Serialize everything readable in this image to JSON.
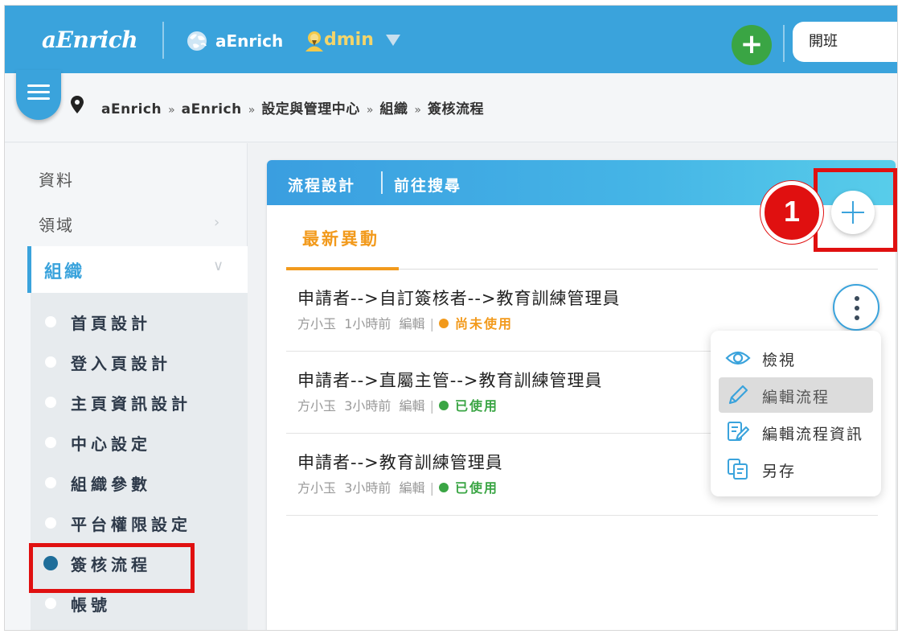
{
  "header": {
    "logo": "aEnrich",
    "org_name": "aEnrich",
    "user_name": "dmin",
    "add_label": "+",
    "search_value": "開班"
  },
  "breadcrumb": [
    "aEnrich",
    "aEnrich",
    "設定與管理中心",
    "組織",
    "簽核流程"
  ],
  "breadcrumb_separator": "»",
  "sidebar": {
    "top_items": [
      {
        "label": "資料"
      },
      {
        "label": "領域"
      }
    ],
    "expanded": {
      "label": "組織"
    },
    "sub_items": [
      {
        "label": "首頁設計"
      },
      {
        "label": "登入頁設計"
      },
      {
        "label": "主頁資訊設計"
      },
      {
        "label": "中心設定"
      },
      {
        "label": "組織參數"
      },
      {
        "label": "平台權限設定"
      },
      {
        "label": "簽核流程",
        "active": true
      },
      {
        "label": "帳號"
      }
    ]
  },
  "card": {
    "title": "流程設計",
    "link": "前往搜尋",
    "tab": "最新異動",
    "rows": [
      {
        "title": "申請者-->自訂簽核者-->教育訓練管理員",
        "author": "方小玉",
        "time": "1小時前",
        "action": "編輯",
        "status": "尚未使用",
        "status_color": "#f29a1c"
      },
      {
        "title": "申請者-->直屬主管-->教育訓練管理員",
        "author": "方小玉",
        "time": "3小時前",
        "action": "編輯",
        "status": "已使用",
        "status_color": "#3aa544"
      },
      {
        "title": "申請者-->教育訓練管理員",
        "author": "方小玉",
        "time": "3小時前",
        "action": "編輯",
        "status": "已使用",
        "status_color": "#3aa544"
      }
    ]
  },
  "dropdown": {
    "items": [
      {
        "label": "檢視",
        "icon": "eye-icon"
      },
      {
        "label": "編輯流程",
        "icon": "pencil-icon",
        "highlighted": true
      },
      {
        "label": "編輯流程資訊",
        "icon": "edit-document-icon"
      },
      {
        "label": "另存",
        "icon": "copy-icon"
      }
    ]
  },
  "callout": {
    "number": "1"
  },
  "colors": {
    "primary": "#3aa3dc",
    "accent_orange": "#f29a1c",
    "success_green": "#3aa544",
    "highlight_red": "#e01010"
  }
}
